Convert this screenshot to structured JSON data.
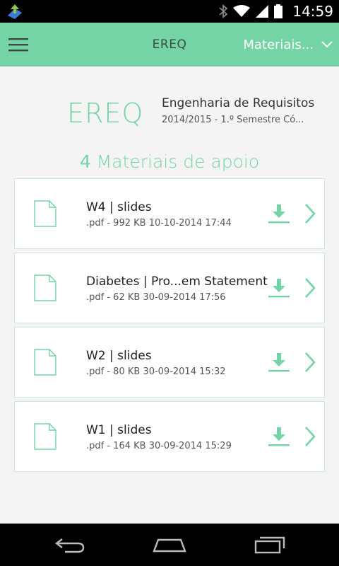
{
  "status_bar": {
    "time": "14:59",
    "icons": [
      "app-update-icon",
      "bluetooth-icon",
      "wifi-icon",
      "signal-icon",
      "battery-icon"
    ]
  },
  "app_bar": {
    "title": "EREQ",
    "menu_icon": "hamburger-menu-icon",
    "section_dropdown": "Materiais...",
    "dropdown_icon": "chevron-down-icon"
  },
  "course": {
    "code": "EREQ",
    "name": "Engenharia de Requisitos",
    "meta": "2014/2015 - 1.º Semestre Có..."
  },
  "section": {
    "count": "4",
    "title": "Materiais de apoio"
  },
  "files": [
    {
      "name": "W4 | slides",
      "meta": ".pdf - 992 KB 10-10-2014 17:44"
    },
    {
      "name": "Diabetes | Pro...em Statement",
      "meta": ".pdf - 62 KB 30-09-2014 17:56"
    },
    {
      "name": "W2 | slides",
      "meta": ".pdf - 80 KB 30-09-2014 15:32"
    },
    {
      "name": "W1 | slides",
      "meta": ".pdf - 164 KB 30-09-2014 15:29"
    }
  ],
  "colors": {
    "accent": "#74d4a6",
    "card_border": "#cfe9dc",
    "background": "#f4f4f4"
  },
  "nav_bar": {
    "icons": [
      "back-icon",
      "home-icon",
      "recent-apps-icon"
    ]
  }
}
